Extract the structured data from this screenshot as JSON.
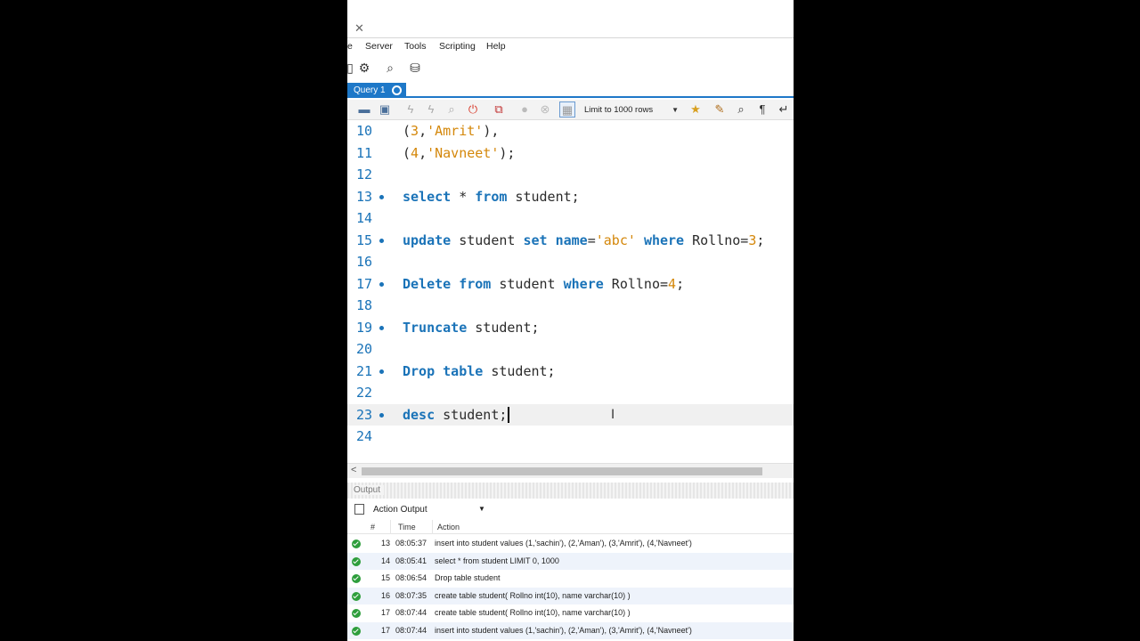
{
  "menu": [
    "e",
    "Server",
    "Tools",
    "Scripting",
    "Help"
  ],
  "tab": {
    "label": "Query 1"
  },
  "toolbar": {
    "limit_label": "Limit to 1000 rows"
  },
  "editor": {
    "lines": [
      {
        "n": "10",
        "dot": false,
        "tokens": [
          [
            "",
            "("
          ],
          [
            "num",
            "3"
          ],
          [
            "",
            ","
          ],
          [
            "str",
            "'Amrit'"
          ],
          [
            "",
            "),"
          ]
        ]
      },
      {
        "n": "11",
        "dot": false,
        "tokens": [
          [
            "",
            "("
          ],
          [
            "num",
            "4"
          ],
          [
            "",
            ","
          ],
          [
            "str",
            "'Navneet'"
          ],
          [
            "",
            ");"
          ]
        ]
      },
      {
        "n": "12",
        "dot": false,
        "tokens": []
      },
      {
        "n": "13",
        "dot": true,
        "tokens": [
          [
            "kw",
            "select"
          ],
          [
            "",
            " * "
          ],
          [
            "kw",
            "from"
          ],
          [
            "",
            " student;"
          ]
        ]
      },
      {
        "n": "14",
        "dot": false,
        "tokens": []
      },
      {
        "n": "15",
        "dot": true,
        "tokens": [
          [
            "kw",
            "update"
          ],
          [
            "",
            " student "
          ],
          [
            "kw",
            "set"
          ],
          [
            "",
            " "
          ],
          [
            "kw",
            "name"
          ],
          [
            "",
            "="
          ],
          [
            "str",
            "'abc'"
          ],
          [
            "",
            " "
          ],
          [
            "kw",
            "where"
          ],
          [
            "",
            " Rollno="
          ],
          [
            "num",
            "3"
          ],
          [
            "",
            ";"
          ]
        ]
      },
      {
        "n": "16",
        "dot": false,
        "tokens": []
      },
      {
        "n": "17",
        "dot": true,
        "tokens": [
          [
            "kw",
            "Delete"
          ],
          [
            "",
            " "
          ],
          [
            "kw",
            "from"
          ],
          [
            "",
            " student "
          ],
          [
            "kw",
            "where"
          ],
          [
            "",
            " Rollno="
          ],
          [
            "num",
            "4"
          ],
          [
            "",
            ";"
          ]
        ]
      },
      {
        "n": "18",
        "dot": false,
        "tokens": []
      },
      {
        "n": "19",
        "dot": true,
        "tokens": [
          [
            "kw",
            "Truncate"
          ],
          [
            "",
            " student;"
          ]
        ]
      },
      {
        "n": "20",
        "dot": false,
        "tokens": []
      },
      {
        "n": "21",
        "dot": true,
        "tokens": [
          [
            "kw",
            "Drop"
          ],
          [
            "",
            " "
          ],
          [
            "kw",
            "table"
          ],
          [
            "",
            " student;"
          ]
        ]
      },
      {
        "n": "22",
        "dot": false,
        "tokens": []
      },
      {
        "n": "23",
        "dot": true,
        "current": true,
        "tokens": [
          [
            "kw",
            "desc"
          ],
          [
            "",
            " student;"
          ]
        ]
      },
      {
        "n": "24",
        "dot": false,
        "tokens": []
      }
    ]
  },
  "output": {
    "title": "Output",
    "selector": "Action Output",
    "columns": {
      "num": "#",
      "time": "Time",
      "action": "Action"
    },
    "rows": [
      {
        "num": "13",
        "time": "08:05:37",
        "action": "insert into student values (1,'sachin'), (2,'Aman'), (3,'Amrit'), (4,'Navneet')"
      },
      {
        "num": "14",
        "time": "08:05:41",
        "action": "select * from student LIMIT 0, 1000"
      },
      {
        "num": "15",
        "time": "08:06:54",
        "action": "Drop table student"
      },
      {
        "num": "16",
        "time": "08:07:35",
        "action": "create table student( Rollno int(10), name varchar(10) )"
      },
      {
        "num": "17",
        "time": "08:07:44",
        "action": "create table student( Rollno int(10), name varchar(10) )"
      },
      {
        "num": "17",
        "time": "08:07:44",
        "action": "insert into student values (1,'sachin'), (2,'Aman'), (3,'Amrit'), (4,'Navneet')"
      }
    ]
  },
  "colors": {
    "keyword": "#1a73b8",
    "string": "#d4870a",
    "tab": "#1e78c8",
    "ok": "#2e9e3c"
  }
}
